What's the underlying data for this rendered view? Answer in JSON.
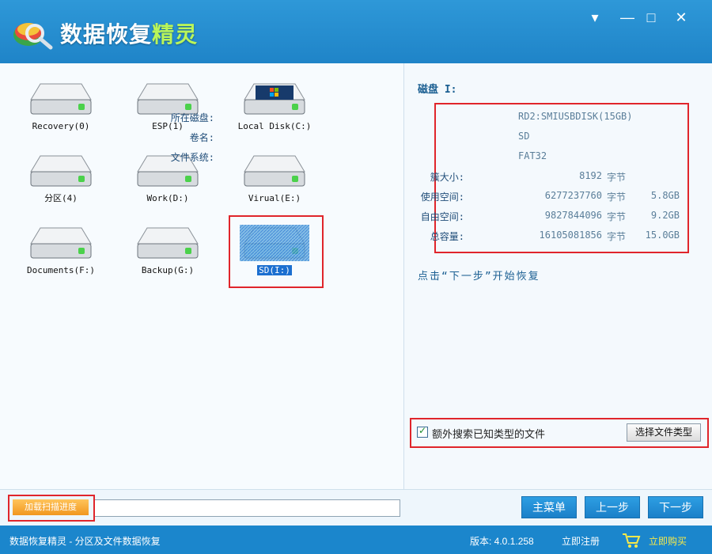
{
  "window": {
    "title_main": "数据恢复",
    "title_accent": "精灵",
    "menu_glyph": "▾",
    "minimize_glyph": "—",
    "maximize_glyph": "□",
    "close_glyph": "✕"
  },
  "disks": [
    {
      "label": "Recovery(0)",
      "icon": "hard-disk-icon",
      "selected": false
    },
    {
      "label": "ESP(1)",
      "icon": "hard-disk-icon",
      "selected": false
    },
    {
      "label": "Local Disk(C:)",
      "icon": "windows-disk-icon",
      "selected": false
    },
    {
      "label": "分区(4)",
      "icon": "hard-disk-icon",
      "selected": false
    },
    {
      "label": "Work(D:)",
      "icon": "hard-disk-icon",
      "selected": false
    },
    {
      "label": "Virual(E:)",
      "icon": "hard-disk-icon",
      "selected": false
    },
    {
      "label": "Documents(F:)",
      "icon": "hard-disk-icon",
      "selected": false
    },
    {
      "label": "Backup(G:)",
      "icon": "hard-disk-icon",
      "selected": false
    },
    {
      "label": "SD(I:)",
      "icon": "hard-disk-icon",
      "selected": true
    }
  ],
  "info": {
    "heading": "磁盘 I:",
    "disk_label": "所在磁盘:",
    "disk_value": "RD2:SMIUSBDISK(15GB)",
    "volume_label": "卷名:",
    "volume_value": "SD",
    "fs_label": "文件系统:",
    "fs_value": "FAT32",
    "cluster_label": "簇大小:",
    "cluster_value": "8192",
    "cluster_unit": "字节",
    "used_label": "使用空间:",
    "used_value": "6277237760",
    "used_unit": "字节",
    "used_human": "5.8GB",
    "free_label": "自由空间:",
    "free_value": "9827844096",
    "free_unit": "字节",
    "free_human": "9.2GB",
    "total_label": "总容量:",
    "total_value": "16105081856",
    "total_unit": "字节",
    "total_human": "15.0GB",
    "hint": "点击“下一步”开始恢复"
  },
  "options": {
    "extra_search_label": "额外搜索已知类型的文件",
    "extra_search_checked": true,
    "choose_types_label": "选择文件类型"
  },
  "bottom": {
    "load_progress_label": "加载扫描进度",
    "main_menu_label": "主菜单",
    "prev_label": "上一步",
    "next_label": "下一步"
  },
  "status": {
    "app_text": "数据恢复精灵 - 分区及文件数据恢复",
    "version_text": "版本: 4.0.1.258",
    "register_text": "立即注册",
    "buy_text": "立即购买"
  },
  "colors": {
    "titlebar": "#2e98d8",
    "accent_green": "#b9f55a",
    "highlight_red": "#e0252b",
    "selection_blue": "#1c6fd0",
    "button_blue": "#1b80c9"
  }
}
